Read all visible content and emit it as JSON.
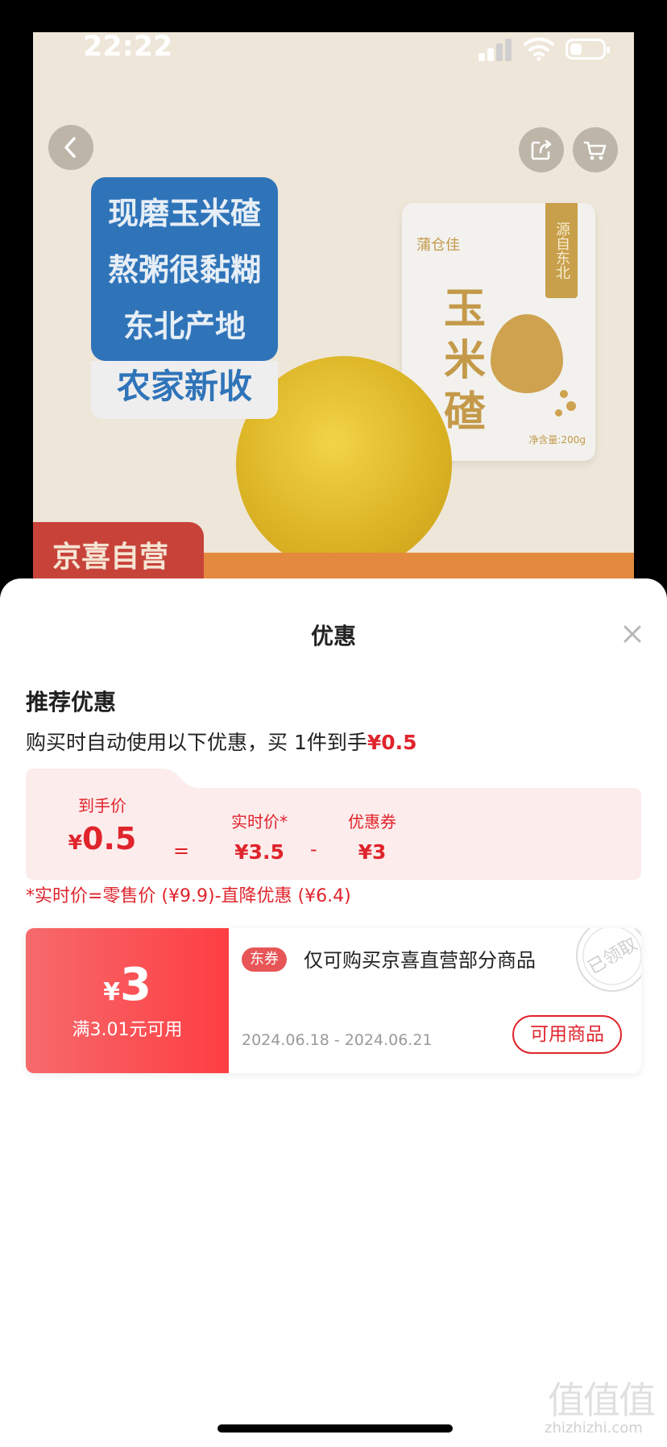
{
  "status_bar": {
    "time": "22:22"
  },
  "product_image": {
    "promo_lines": [
      "现磨玉米碴",
      "熬粥很黏糊",
      "东北产地"
    ],
    "promo_highlight": "农家新收",
    "bag": {
      "brand": "蒲仓佳",
      "ribbon": "源自东北",
      "title": "玉米碴",
      "weight": "净含量:200g"
    },
    "tag": "京喜自营"
  },
  "sheet": {
    "title": "优惠",
    "section_title": "推荐优惠",
    "desc_prefix": "购买时自动使用以下优惠，买 1件到手",
    "desc_price": "¥0.5",
    "calc": {
      "final_label": "到手价",
      "final_currency": "¥",
      "final_value": "0.5",
      "eq": "=",
      "realtime_label": "实时价*",
      "realtime_value": "¥3.5",
      "minus": "-",
      "coupon_label": "优惠券",
      "coupon_value": "¥3"
    },
    "note": "*实时价=零售价 (¥9.9)-直降优惠 (¥6.4)",
    "coupon": {
      "currency": "¥",
      "amount": "3",
      "condition": "满3.01元可用",
      "badge": "东券",
      "description": "仅可购买京喜直营部分商品",
      "date_range": "2024.06.18 - 2024.06.21",
      "button": "可用商品",
      "stamp": "已领取"
    }
  },
  "watermark": {
    "logo": "值值值",
    "url": "zhizhizhi.com"
  },
  "colors": {
    "accent_red": "#e0242c",
    "coupon_gradient_start": "#f66a6c",
    "coupon_gradient_end": "#fe3e43"
  }
}
